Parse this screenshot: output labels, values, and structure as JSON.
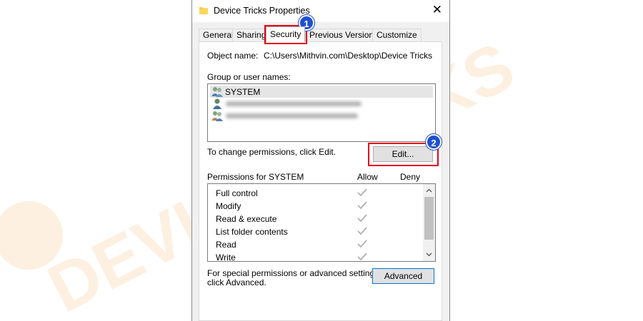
{
  "window": {
    "title": "Device Tricks Properties",
    "close_glyph": "✕"
  },
  "tabs": [
    {
      "label": "General"
    },
    {
      "label": "Sharing"
    },
    {
      "label": "Security",
      "active": true
    },
    {
      "label": "Previous Versions"
    },
    {
      "label": "Customize"
    }
  ],
  "security": {
    "object_name_label": "Object name:",
    "object_name_value": "C:\\Users\\Mithvin.com\\Desktop\\Device Tricks",
    "group_label": "Group or user names:",
    "users": [
      {
        "name": "SYSTEM",
        "icon": "user-group-icon",
        "selected": true
      },
      {
        "name": "",
        "icon": "user-icon",
        "obscured": true
      },
      {
        "name": "",
        "icon": "user-group-icon",
        "obscured": true
      }
    ],
    "change_text": "To change permissions, click Edit.",
    "edit_button": "Edit...",
    "permissions_label": "Permissions for SYSTEM",
    "allow_label": "Allow",
    "deny_label": "Deny",
    "permissions": [
      {
        "name": "Full control",
        "allow": true,
        "deny": false
      },
      {
        "name": "Modify",
        "allow": true,
        "deny": false
      },
      {
        "name": "Read & execute",
        "allow": true,
        "deny": false
      },
      {
        "name": "List folder contents",
        "allow": true,
        "deny": false
      },
      {
        "name": "Read",
        "allow": true,
        "deny": false
      },
      {
        "name": "Write",
        "allow": true,
        "deny": false
      }
    ],
    "advanced_text_line1": "For special permissions or advanced settings,",
    "advanced_text_line2": "click Advanced.",
    "advanced_button": "Advanced"
  },
  "annotations": [
    {
      "number": "1",
      "target": "Security tab"
    },
    {
      "number": "2",
      "target": "Edit button"
    }
  ],
  "colors": {
    "highlight_red": "#e3001b",
    "badge_blue": "#1f4fd1",
    "accent_blue": "#0078d7",
    "watermark_orange": "#f7941d"
  }
}
